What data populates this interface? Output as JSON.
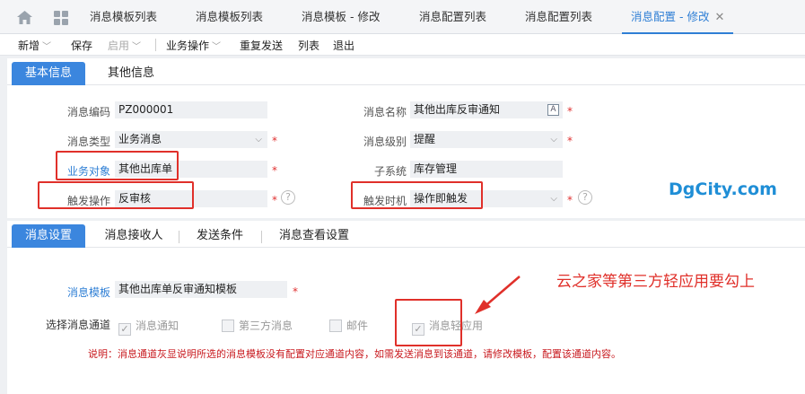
{
  "tabs": {
    "t1": "消息模板列表",
    "t2": "消息模板列表",
    "t3": "消息模板 - 修改",
    "t4": "消息配置列表",
    "t5": "消息配置列表",
    "t6": "消息配置 - 修改",
    "close": "✕"
  },
  "toolbar": {
    "new": "新增",
    "save": "保存",
    "enable": "启用",
    "business_ops": "业务操作",
    "resend": "重复发送",
    "list": "列表",
    "exit": "退出"
  },
  "section1": {
    "tab_basic": "基本信息",
    "tab_other": "其他信息",
    "code_label": "消息编码",
    "code_value": "PZ000001",
    "name_label": "消息名称",
    "name_value": "其他出库反审通知",
    "type_label": "消息类型",
    "type_value": "业务消息",
    "level_label": "消息级别",
    "level_value": "提醒",
    "object_label": "业务对象",
    "object_value": "其他出库单",
    "subsystem_label": "子系统",
    "subsystem_value": "库存管理",
    "trigger_op_label": "触发操作",
    "trigger_op_value": "反审核",
    "trigger_time_label": "触发时机",
    "trigger_time_value": "操作即触发"
  },
  "watermark": "DgCity.com",
  "section2": {
    "tab_settings": "消息设置",
    "tab_receivers": "消息接收人",
    "tab_conditions": "发送条件",
    "tab_view": "消息查看设置",
    "template_label": "消息模板",
    "template_value": "其他出库单反审通知模板",
    "channel_label": "选择消息通道",
    "ch_notice": "消息通知",
    "ch_third": "第三方消息",
    "ch_mail": "邮件",
    "ch_light": "消息轻应用",
    "note": "说明：消息通道灰显说明所选的消息模板没有配置对应通道内容，如需发送消息到该通道，请修改模板，配置该通道内容。",
    "annotation": "云之家等第三方轻应用要勾上"
  },
  "symbols": {
    "required": "*",
    "help": "?",
    "check": "✓",
    "chevron": "⌵",
    "caret": "﹀",
    "a_icon": "A"
  }
}
